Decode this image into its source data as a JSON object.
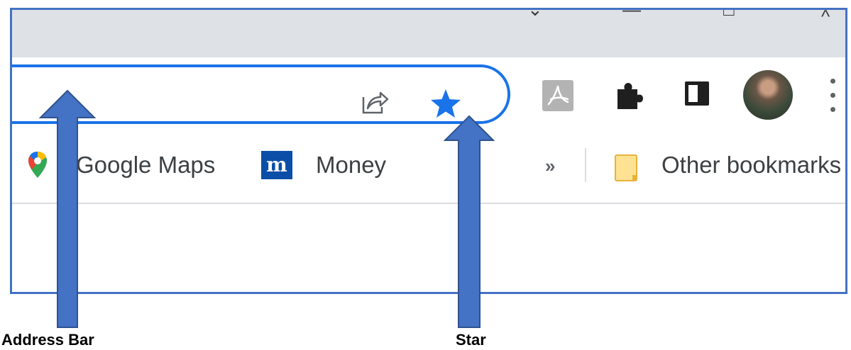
{
  "window": {
    "controls": {
      "tab_search": "⌄",
      "minimize": "—",
      "restore": "□",
      "caret": "^"
    }
  },
  "toolbar": {
    "share_icon": "share-icon",
    "star_icon": "star-icon",
    "extensions": [
      "pdf-extension-icon",
      "puzzle-icon",
      "side-panel-icon"
    ],
    "avatar": "profile-avatar",
    "menu_icon": "more-vertical-icon"
  },
  "bookmarks": {
    "items": [
      {
        "icon": "google-maps-icon",
        "label": "Google Maps"
      },
      {
        "icon": "money-icon",
        "label": "Money",
        "icon_glyph": "m"
      }
    ],
    "overflow_label": "»",
    "other": {
      "icon": "folder-icon",
      "label": "Other bookmarks"
    }
  },
  "annotations": {
    "address_bar": "Address Bar",
    "star": "Star"
  },
  "colors": {
    "accent": "#1a73e8",
    "arrow_fill": "#4472c4",
    "arrow_stroke": "#2f528f",
    "frame": "#4472c4",
    "tabstrip": "#dee1e6"
  }
}
